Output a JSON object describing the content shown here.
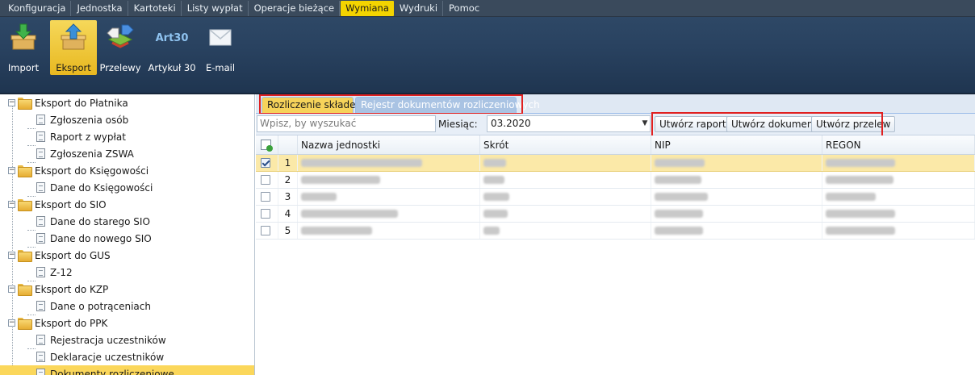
{
  "menu": {
    "items": [
      {
        "label": "Konfiguracja",
        "active": false
      },
      {
        "label": "Jednostka",
        "active": false
      },
      {
        "label": "Kartoteki",
        "active": false
      },
      {
        "label": "Listy wypłat",
        "active": false
      },
      {
        "label": "Operacje bieżące",
        "active": false
      },
      {
        "label": "Wymiana",
        "active": true
      },
      {
        "label": "Wydruki",
        "active": false
      },
      {
        "label": "Pomoc",
        "active": false
      }
    ]
  },
  "ribbon": {
    "buttons": [
      {
        "label": "Import",
        "icon": "import-box-icon",
        "active": false
      },
      {
        "label": "Eksport",
        "icon": "export-box-icon",
        "active": true
      },
      {
        "label": "Przelewy",
        "icon": "transfer-icon",
        "active": false
      },
      {
        "label": "Artykuł 30",
        "icon": "art30-icon",
        "icon_text": "Art30",
        "active": false
      },
      {
        "label": "E-mail",
        "icon": "envelope-icon",
        "active": false
      }
    ]
  },
  "tree": {
    "nodes": [
      {
        "label": "Eksport do Płatnika",
        "level": 0
      },
      {
        "label": "Zgłoszenia osób",
        "level": 1
      },
      {
        "label": "Raport z wypłat",
        "level": 1
      },
      {
        "label": "Zgłoszenia ZSWA",
        "level": 1
      },
      {
        "label": "Eksport do Księgowości",
        "level": 0
      },
      {
        "label": "Dane do Księgowości",
        "level": 1
      },
      {
        "label": "Eksport do SIO",
        "level": 0
      },
      {
        "label": "Dane do starego SIO",
        "level": 1
      },
      {
        "label": "Dane do nowego SIO",
        "level": 1
      },
      {
        "label": "Eksport do GUS",
        "level": 0
      },
      {
        "label": "Z-12",
        "level": 1
      },
      {
        "label": "Eksport do KZP",
        "level": 0
      },
      {
        "label": "Dane o potrąceniach",
        "level": 1
      },
      {
        "label": "Eksport do PPK",
        "level": 0
      },
      {
        "label": "Rejestracja uczestników",
        "level": 1
      },
      {
        "label": "Deklaracje uczestników",
        "level": 1
      },
      {
        "label": "Dokumenty rozliczeniowe",
        "level": 1,
        "selected": true
      }
    ]
  },
  "tabs": {
    "active": "Rozliczenie składek",
    "inactive": "Rejestr dokumentów rozliczeniowych"
  },
  "toolbar": {
    "search_placeholder": "Wpisz, by wyszukać",
    "month_label": "Miesiąc:",
    "month_value": "03.2020",
    "btn_report": "Utwórz raport",
    "btn_document": "Utwórz dokument",
    "btn_transfer": "Utwórz przelew"
  },
  "grid": {
    "columns": [
      "Nazwa jednostki",
      "Skrót",
      "NIP",
      "REGON"
    ],
    "rows": [
      {
        "num": "1",
        "checked": true
      },
      {
        "num": "2",
        "checked": false
      },
      {
        "num": "3",
        "checked": false
      },
      {
        "num": "4",
        "checked": false
      },
      {
        "num": "5",
        "checked": false
      }
    ]
  },
  "colors": {
    "accent_yellow": "#f4d400",
    "ribbon_blue": "#294260",
    "highlight_red": "#e02020",
    "selection": "#fbe9a8"
  }
}
